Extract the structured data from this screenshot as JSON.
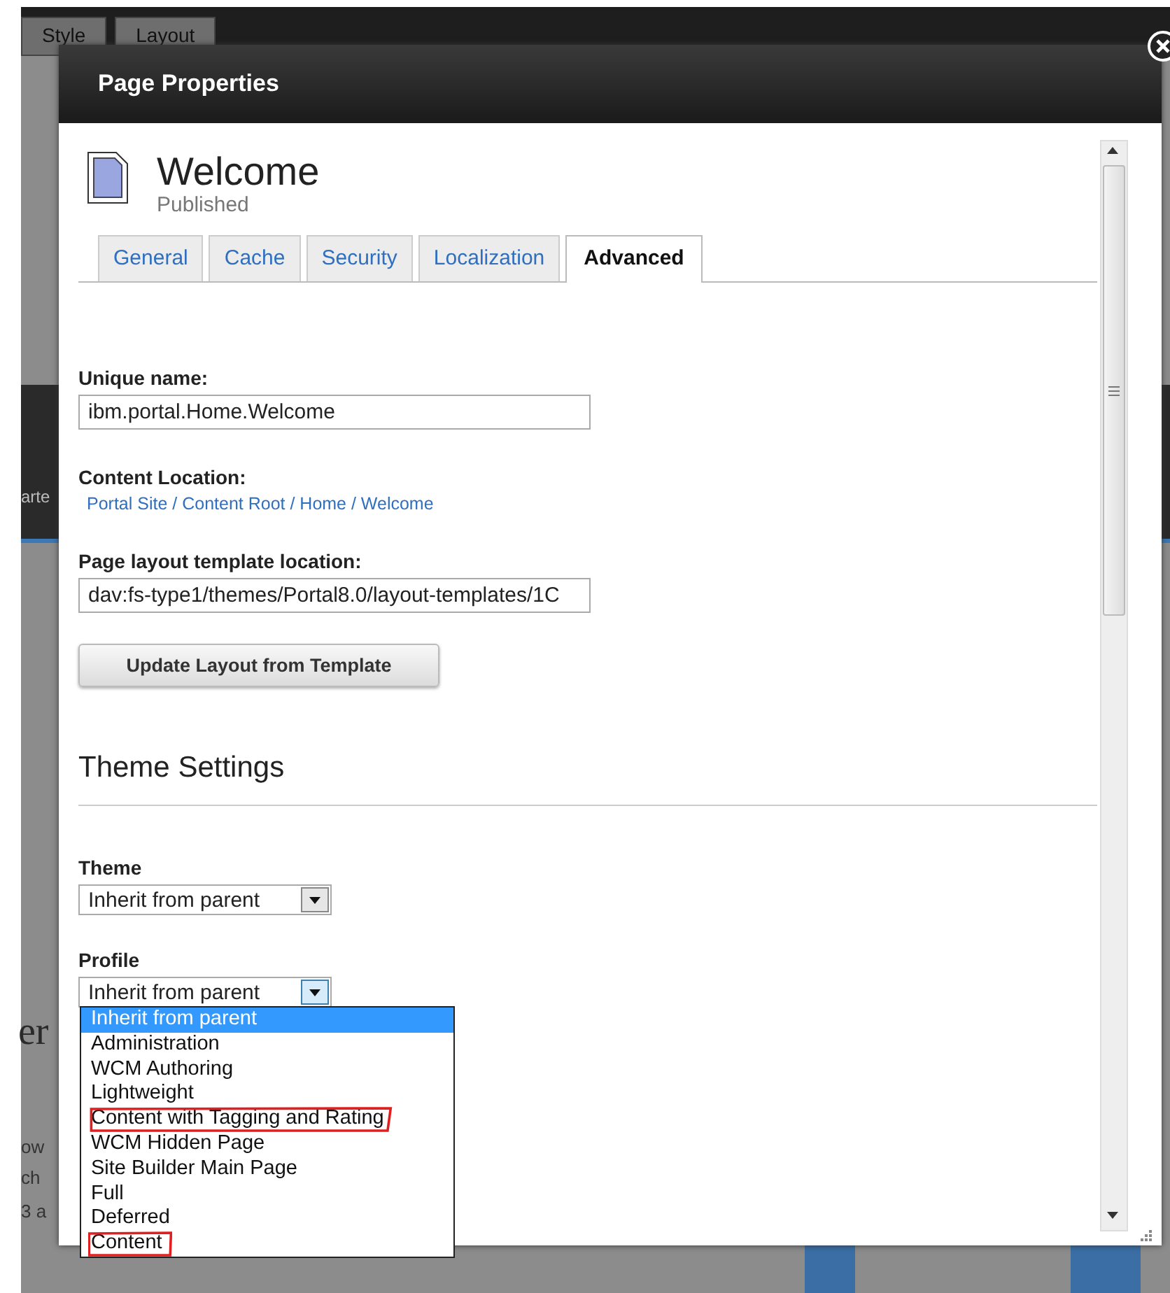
{
  "background": {
    "tabs": [
      {
        "label": "Style"
      },
      {
        "label": "Layout"
      }
    ],
    "fragments": [
      {
        "kind": "dark",
        "text": "arte"
      },
      {
        "kind": "heading",
        "text": "er"
      },
      {
        "kind": "body",
        "text": "ow"
      },
      {
        "kind": "body",
        "text": "ch"
      },
      {
        "kind": "body",
        "text": "3 a"
      }
    ]
  },
  "dialog": {
    "title": "Page Properties",
    "page": {
      "name": "Welcome",
      "status": "Published"
    },
    "tabs": [
      {
        "label": "General",
        "selected": false
      },
      {
        "label": "Cache",
        "selected": false
      },
      {
        "label": "Security",
        "selected": false
      },
      {
        "label": "Localization",
        "selected": false
      },
      {
        "label": "Advanced",
        "selected": true
      }
    ],
    "fields": [
      {
        "kind": "input",
        "label": "Unique name:",
        "value": "ibm.portal.Home.Welcome"
      },
      {
        "kind": "link",
        "label": "Content Location:",
        "value": "Portal Site / Content Root / Home / Welcome"
      },
      {
        "kind": "input",
        "label": "Page layout template location:",
        "value": "dav:fs-type1/themes/Portal8.0/layout-templates/1C"
      },
      {
        "kind": "button",
        "value": "Update Layout from Template"
      }
    ],
    "section_title": "Theme Settings",
    "selects": [
      {
        "label": "Theme",
        "value": "Inherit from parent",
        "expanded": false
      },
      {
        "label": "Profile",
        "value": "Inherit from parent",
        "expanded": true,
        "options": [
          {
            "label": "Inherit from parent",
            "selected": true,
            "circled": false
          },
          {
            "label": "Administration",
            "selected": false,
            "circled": false
          },
          {
            "label": "WCM Authoring",
            "selected": false,
            "circled": false
          },
          {
            "label": "Lightweight",
            "selected": false,
            "circled": false
          },
          {
            "label": "Content with Tagging and Rating",
            "selected": false,
            "circled": true
          },
          {
            "label": "WCM Hidden Page",
            "selected": false,
            "circled": false
          },
          {
            "label": "Site Builder Main Page",
            "selected": false,
            "circled": false
          },
          {
            "label": "Full",
            "selected": false,
            "circled": false
          },
          {
            "label": "Deferred",
            "selected": false,
            "circled": false
          },
          {
            "label": "Content",
            "selected": false,
            "circled": true
          }
        ]
      }
    ]
  }
}
